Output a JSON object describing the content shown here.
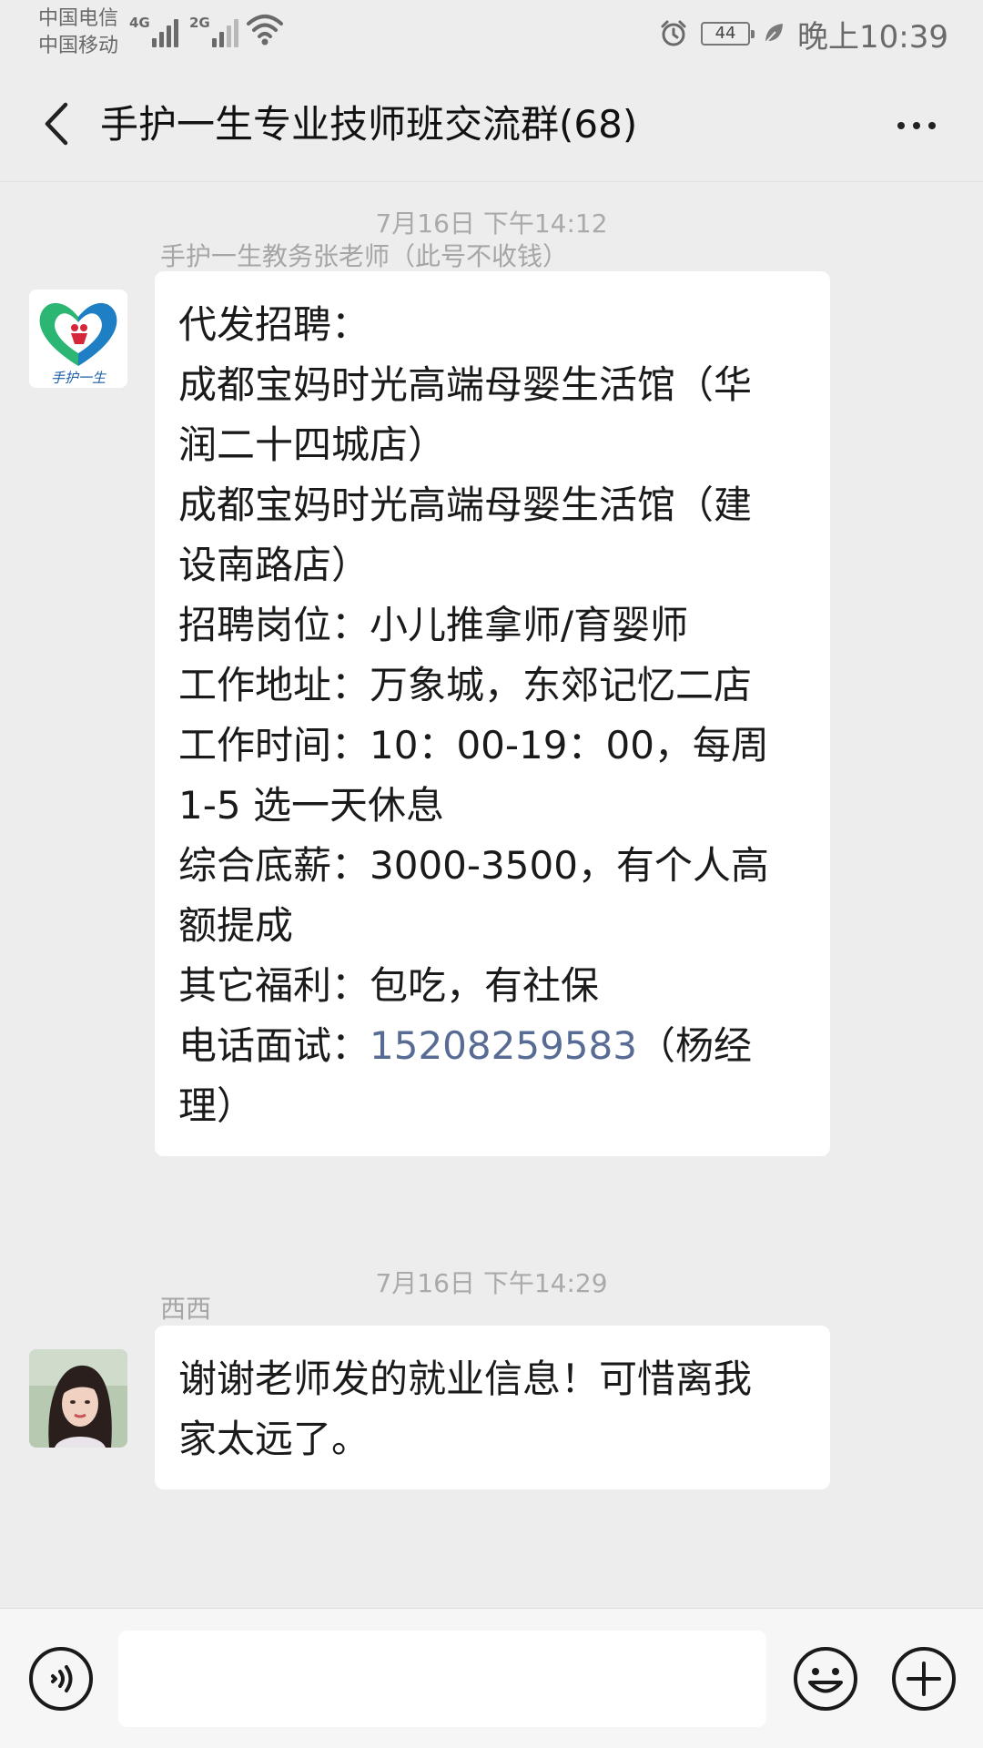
{
  "status_bar": {
    "carrier_1": "中国电信",
    "carrier_2": "中国移动",
    "net_1": "4G",
    "net_2": "2G",
    "battery": "44",
    "time": "晚上10:39"
  },
  "header": {
    "title": "手护一生专业技师班交流群(68)"
  },
  "messages": [
    {
      "timestamp": "7月16日 下午14:12",
      "sender": "手护一生教务张老师（此号不收钱）",
      "avatar_text": "手护一生",
      "lines": [
        "代发招聘：",
        "成都宝妈时光高端母婴生活馆（华",
        "润二十四城店）",
        "成都宝妈时光高端母婴生活馆（建",
        "设南路店）",
        "招聘岗位：小儿推拿师/育婴师",
        "工作地址：万象城，东郊记忆二店",
        "工作时间：10：00-19：00，每周",
        "1-5 选一天休息",
        "综合底薪：3000-3500，有个人高",
        "额提成",
        "其它福利：包吃，有社保"
      ],
      "phone_prefix": "电话面试：",
      "phone": "15208259583",
      "phone_suffix": "（杨经",
      "last_line": "理）"
    },
    {
      "timestamp": "7月16日 下午14:29",
      "sender": "西西",
      "lines": [
        "谢谢老师发的就业信息！可惜离我",
        "家太远了。"
      ]
    }
  ],
  "colors": {
    "background": "#ededed",
    "bubble": "#ffffff",
    "link": "#576b95",
    "logo_green": "#2bb673",
    "logo_blue": "#1e7fc4",
    "logo_red": "#d6263a"
  }
}
